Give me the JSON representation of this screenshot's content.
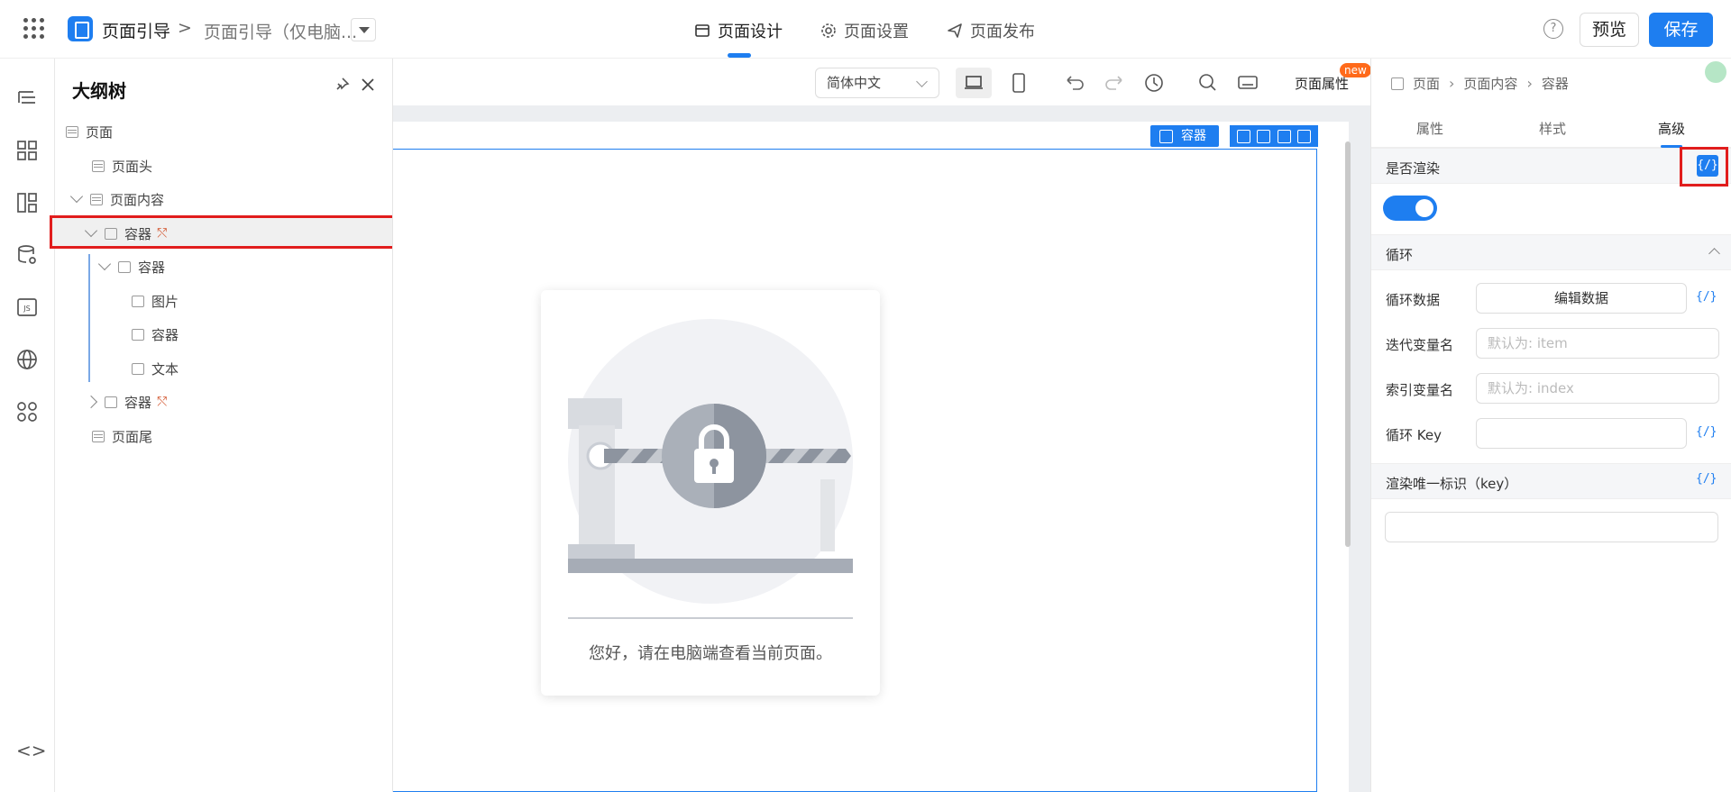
{
  "header": {
    "app_name": "页面引导",
    "breadcrumb_sep": ">",
    "page_name": "页面引导（仅电脑...",
    "tabs": [
      {
        "label": "页面设计",
        "icon": "layout-icon"
      },
      {
        "label": "页面设置",
        "icon": "gear-icon"
      },
      {
        "label": "页面发布",
        "icon": "send-icon"
      }
    ],
    "help": "?",
    "preview_label": "预览",
    "save_label": "保存"
  },
  "rail": {
    "icons": [
      "outline-icon",
      "components-icon",
      "layout-icon",
      "datasource-icon",
      "js-icon",
      "globe-icon",
      "apps-icon"
    ],
    "bottom_toggle": "<>"
  },
  "outline": {
    "title": "大纲树",
    "nodes": [
      {
        "label": "页面"
      },
      {
        "label": "页面头"
      },
      {
        "label": "页面内容"
      },
      {
        "label": "容器"
      },
      {
        "label": "容器"
      },
      {
        "label": "图片"
      },
      {
        "label": "容器"
      },
      {
        "label": "文本"
      },
      {
        "label": "容器"
      },
      {
        "label": "页面尾"
      }
    ]
  },
  "toolbar": {
    "language": "简体中文",
    "page_attr": "页面属性",
    "new_badge": "new"
  },
  "canvas": {
    "selected_tag": "容器",
    "card_message": "您好，请在电脑端查看当前页面。"
  },
  "right_panel": {
    "breadcrumb": [
      "页面",
      "页面内容",
      "容器"
    ],
    "tabs": [
      "属性",
      "样式",
      "高级"
    ],
    "render_label": "是否渲染",
    "code_symbol": "{/}",
    "loop_section": "循环",
    "loop_data_label": "循环数据",
    "loop_data_button": "编辑数据",
    "iter_var_label": "迭代变量名",
    "iter_var_placeholder": "默认为: item",
    "index_var_label": "索引变量名",
    "index_var_placeholder": "默认为: index",
    "loop_key_label": "循环 Key",
    "render_key_label": "渲染唯一标识（key）"
  },
  "colors": {
    "accent": "#1e7ef0",
    "highlight_border": "#e11d1d",
    "new_badge": "#ff6a1a"
  }
}
